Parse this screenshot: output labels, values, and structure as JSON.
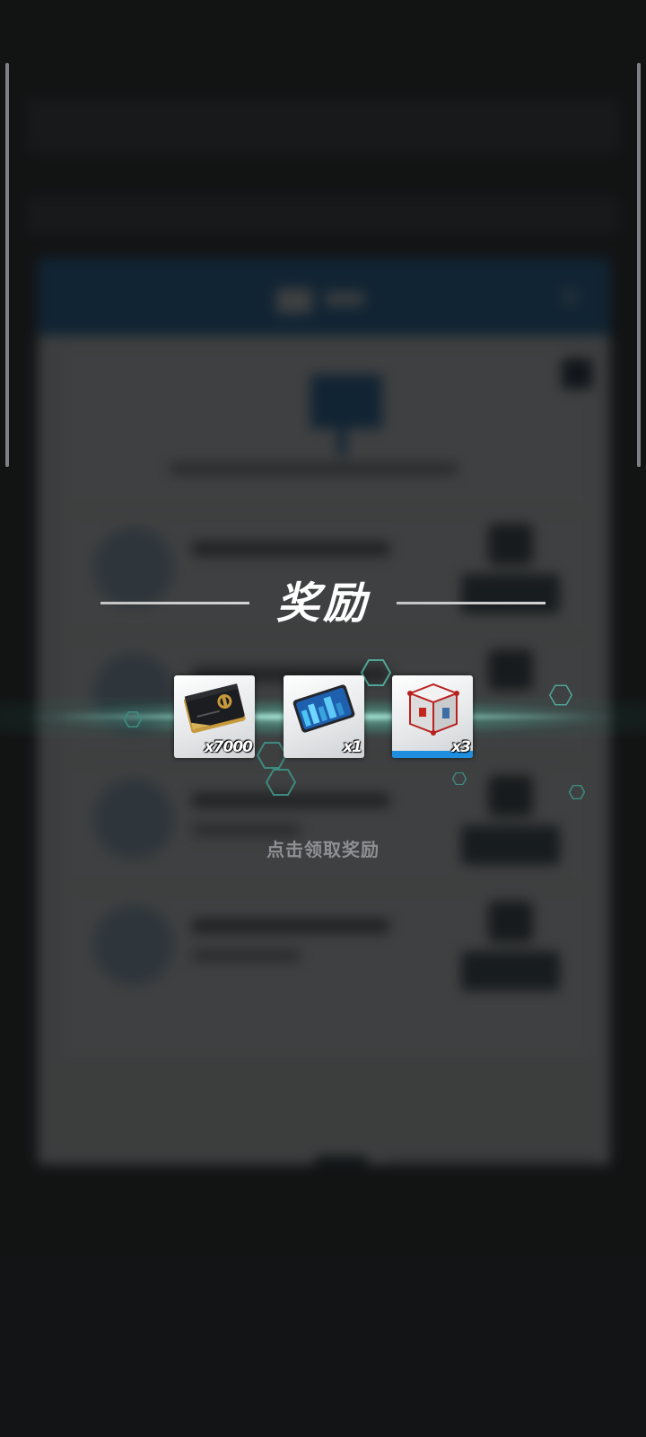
{
  "reward_popup": {
    "title": "奖励",
    "items": [
      {
        "name": "currency-card",
        "quantity_label": "x7000",
        "quantity": 7000,
        "rarity_color": "#e0a94a"
      },
      {
        "name": "blue-card",
        "quantity_label": "x1",
        "quantity": 1,
        "rarity_color": "#1e8ee0"
      },
      {
        "name": "supply-crate",
        "quantity_label": "x3",
        "quantity": 3,
        "rarity_color": "#1e8ee0"
      }
    ],
    "hint": "点击领取奖励"
  },
  "colors": {
    "background": "#202224",
    "dialog_header_blue": "#1f6fb7",
    "glow": "#96ffe1",
    "title_text": "#ffffff",
    "hint_text": "#8d9094"
  }
}
